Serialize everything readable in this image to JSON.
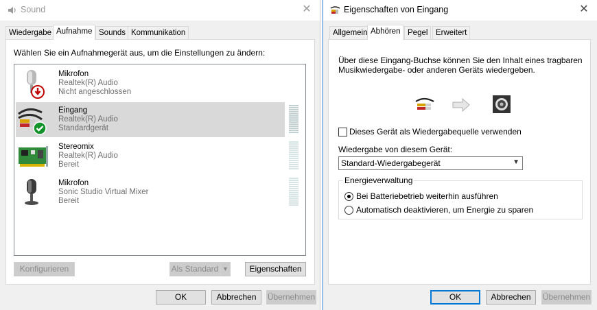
{
  "sound_window": {
    "title": "Sound",
    "close_glyph": "✕",
    "tabs": [
      {
        "label": "Wiedergabe",
        "active": false
      },
      {
        "label": "Aufnahme",
        "active": true
      },
      {
        "label": "Sounds",
        "active": false
      },
      {
        "label": "Kommunikation",
        "active": false
      }
    ],
    "instruction": "Wählen Sie ein Aufnahmegerät aus, um die Einstellungen zu ändern:",
    "devices": [
      {
        "name": "Mikrofon",
        "driver": "Realtek(R) Audio",
        "status": "Nicht angeschlossen",
        "icon": "microphone-disconnected-icon",
        "selected": false
      },
      {
        "name": "Eingang",
        "driver": "Realtek(R) Audio",
        "status": "Standardgerät",
        "icon": "line-in-default-icon",
        "selected": true
      },
      {
        "name": "Stereomix",
        "driver": "Realtek(R) Audio",
        "status": "Bereit",
        "icon": "sound-card-icon",
        "selected": false
      },
      {
        "name": "Mikrofon",
        "driver": "Sonic Studio Virtual Mixer",
        "status": "Bereit",
        "icon": "microphone-icon",
        "selected": false
      }
    ],
    "buttons": {
      "configure": "Konfigurieren",
      "set_default": "Als Standard",
      "properties": "Eigenschaften",
      "ok": "OK",
      "cancel": "Abbrechen",
      "apply": "Übernehmen"
    }
  },
  "props_window": {
    "title": "Eigenschaften von Eingang",
    "close_glyph": "✕",
    "tabs": [
      {
        "label": "Allgemein",
        "active": false
      },
      {
        "label": "Abhören",
        "active": true
      },
      {
        "label": "Pegel",
        "active": false
      },
      {
        "label": "Erweitert",
        "active": false
      }
    ],
    "description": "Über diese Eingang-Buchse können Sie den Inhalt eines tragbaren Musikwiedergabe- oder anderen Geräts wiedergeben.",
    "description_line1": "Über diese Eingang-Buchse können Sie den Inhalt eines tragbaren",
    "description_line2": "Musikwiedergabe- oder anderen Geräts wiedergeben.",
    "listen_checkbox": {
      "label": "Dieses Gerät als Wiedergabequelle verwenden",
      "checked": false
    },
    "playback_label": "Wiedergabe von diesem Gerät:",
    "playback_select": "Standard-Wiedergabegerät",
    "power": {
      "title": "Energieverwaltung",
      "options": [
        {
          "label": "Bei Batteriebetrieb weiterhin ausführen",
          "selected": true
        },
        {
          "label": "Automatisch deaktivieren, um Energie zu sparen",
          "selected": false
        }
      ]
    },
    "buttons": {
      "ok": "OK",
      "cancel": "Abbrechen",
      "apply": "Übernehmen"
    }
  }
}
